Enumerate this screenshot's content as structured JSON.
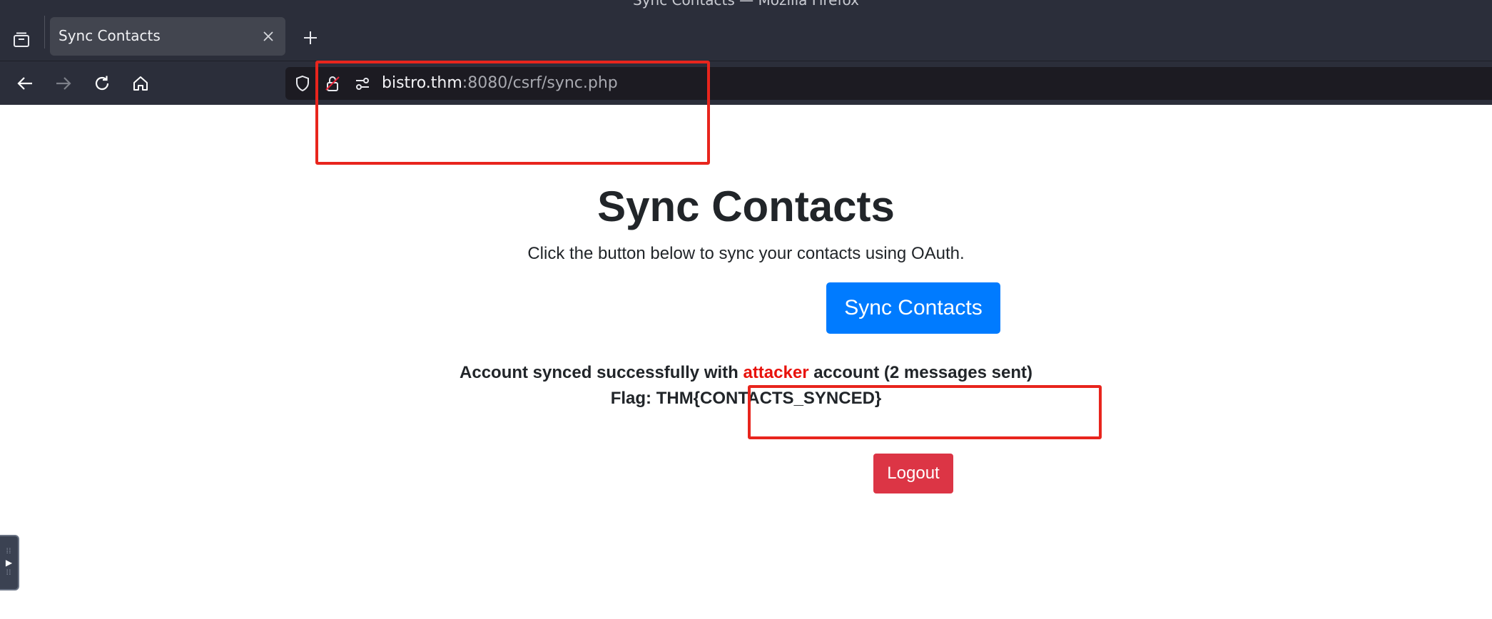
{
  "window": {
    "title": "Sync Contacts — Mozilla Firefox"
  },
  "tabs": [
    {
      "title": "Sync Contacts"
    }
  ],
  "url": {
    "host": "bistro.thm",
    "rest": ":8080/csrf/sync.php"
  },
  "page": {
    "heading": "Sync Contacts",
    "subtitle": "Click the button below to sync your contacts using OAuth.",
    "sync_button": "Sync Contacts",
    "status_prefix": "Account synced successfully with ",
    "status_highlight": "attacker",
    "status_suffix": " account (2 messages sent)",
    "flag": "Flag: THM{CONTACTS_SYNCED}",
    "logout_button": "Logout"
  },
  "colors": {
    "chrome": "#2b2e3a",
    "primary_button": "#007bff",
    "danger_button": "#dc3545",
    "highlight_text": "#e8120c",
    "annotation": "#e8251d"
  }
}
